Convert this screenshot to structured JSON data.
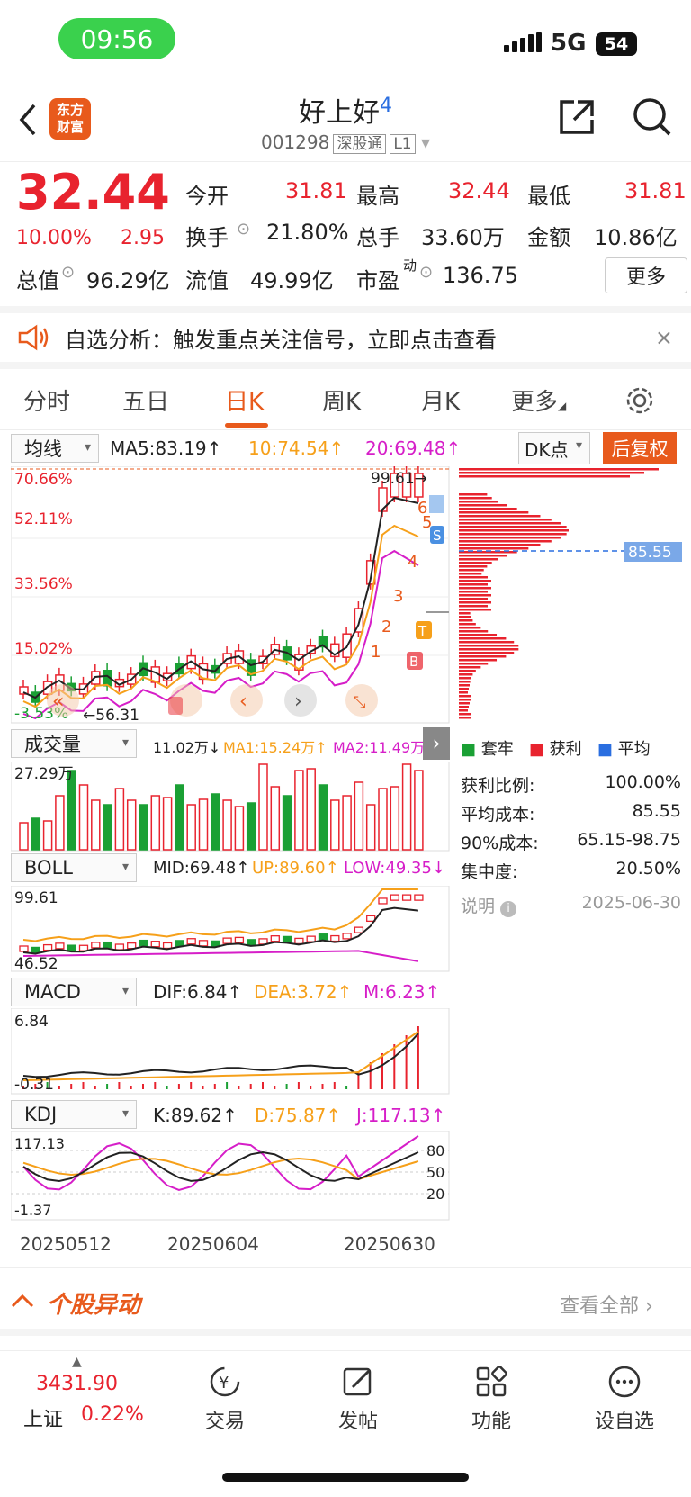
{
  "status": {
    "time": "09:56",
    "network": "5G",
    "battery": "54"
  },
  "header": {
    "logo_text": "东方\n财富",
    "name": "好上好",
    "badge": "4",
    "code": "001298",
    "tag1": "深股通",
    "tag2": "L1"
  },
  "quote": {
    "price": "32.44",
    "change_pct": "10.00%",
    "change": "2.95",
    "open_label": "今开",
    "open": "31.81",
    "high_label": "最高",
    "high": "32.44",
    "low_label": "最低",
    "low": "31.81",
    "turnover_label": "换手",
    "turnover": "21.80%",
    "volume_label": "总手",
    "volume": "33.60万",
    "amount_label": "金额",
    "amount": "10.86亿",
    "mktcap_label": "总值",
    "mktcap": "96.29亿",
    "float_label": "流值",
    "float": "49.99亿",
    "pe_label": "市盈",
    "pe_sup": "动",
    "pe": "136.75",
    "more": "更多"
  },
  "banner": {
    "text": "自选分析：触发重点关注信号，立即点击查看"
  },
  "tabs": [
    "分时",
    "五日",
    "日K",
    "周K",
    "月K",
    "更多"
  ],
  "main_indicator": {
    "select": "均线",
    "ma5": "MA5:83.19↑",
    "ma10": "10:74.54↑",
    "ma20": "20:69.48↑",
    "dk": "DK点",
    "fq": "后复权"
  },
  "kline": {
    "labels": [
      "70.66%",
      "52.11%",
      "33.56%",
      "15.02%",
      "-3.53%"
    ],
    "max_label": "99.61",
    "min_label": "56.31",
    "avg_cost": "85.55"
  },
  "volume_ind": {
    "select": "成交量",
    "v": "11.02万↓",
    "ma1": "MA1:15.24万↑",
    "ma2": "MA2:11.49万",
    "top": "27.29万"
  },
  "boll": {
    "select": "BOLL",
    "mid": "MID:69.48↑",
    "up": "UP:89.60↑",
    "low": "LOW:49.35↓",
    "top": "99.61",
    "bottom": "46.52"
  },
  "macd": {
    "select": "MACD",
    "dif": "DIF:6.84↑",
    "dea": "DEA:3.72↑",
    "m": "M:6.23↑",
    "top": "6.84",
    "bottom": "-0.31"
  },
  "kdj": {
    "select": "KDJ",
    "k": "K:89.62↑",
    "d": "D:75.87↑",
    "j": "J:117.13↑",
    "top": "117.13",
    "bottom": "-1.37",
    "l80": "80",
    "l50": "50",
    "l20": "20"
  },
  "dates": [
    "20250512",
    "20250604",
    "20250630"
  ],
  "chip": {
    "legend": [
      "套牢",
      "获利",
      "平均"
    ],
    "rows": [
      {
        "k": "获利比例:",
        "v": "100.00%"
      },
      {
        "k": "平均成本:",
        "v": "85.55"
      },
      {
        "k": "90%成本:",
        "v": "65.15-98.75"
      },
      {
        "k": "集中度:",
        "v": "20.50%"
      }
    ],
    "note": "说明",
    "date": "2025-06-30"
  },
  "gudong": {
    "title": "个股异动",
    "link": "查看全部"
  },
  "bottom": {
    "index_value": "3431.90",
    "index_name": "上证",
    "index_pct": "0.22%",
    "items": [
      "交易",
      "发帖",
      "功能",
      "设自选"
    ]
  },
  "colors": {
    "up": "#e8232e",
    "down": "#1aa034",
    "accent": "#e85a1c",
    "ma10": "#f6a01a",
    "ma20": "#d61ec8"
  }
}
